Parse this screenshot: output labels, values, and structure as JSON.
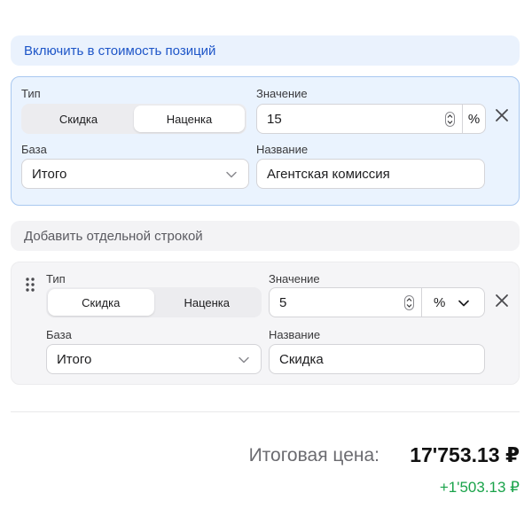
{
  "sections": {
    "included": {
      "title": "Включить в стоимость позиций"
    },
    "separate": {
      "title": "Добавить отдельной строкой"
    }
  },
  "included_row": {
    "type_label": "Тип",
    "type_options": [
      "Скидка",
      "Наценка"
    ],
    "type_selected": "Наценка",
    "value_label": "Значение",
    "value": "15",
    "unit": "%",
    "base_label": "База",
    "base_value": "Итого",
    "name_label": "Название",
    "name_value": "Агентская комиссия"
  },
  "separate_row": {
    "type_label": "Тип",
    "type_options": [
      "Скидка",
      "Наценка"
    ],
    "type_selected": "Скидка",
    "value_label": "Значение",
    "value": "5",
    "unit": "%",
    "base_label": "База",
    "base_value": "Итого",
    "name_label": "Название",
    "name_value": "Скидка"
  },
  "totals": {
    "label": "Итоговая цена:",
    "value": "17'753.13 ₽",
    "difference": "+1'503.13 ₽"
  },
  "colors": {
    "accent_blue": "#1e56c8",
    "active_card_bg": "#eaf3fe",
    "positive_green": "#1aa34a"
  },
  "icons": [
    "chevron-down-icon",
    "stepper-icon",
    "close-icon",
    "drag-handle-icon"
  ]
}
